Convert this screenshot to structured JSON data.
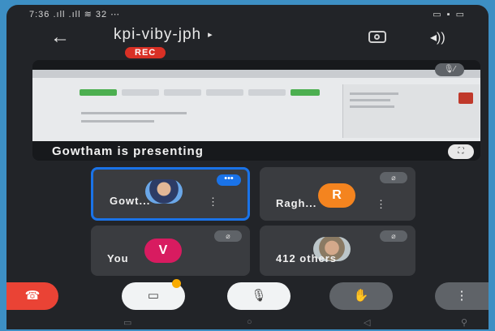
{
  "status_bar": {
    "left": "7:36 .ıll .ıll ≋ 32 ⋯",
    "right": "▭ ▪ ▭"
  },
  "header": {
    "meeting_name": "kpi-viby-jph",
    "caret": "▸",
    "rec_label": "REC",
    "back": "←",
    "speaker": "◂))"
  },
  "presentation": {
    "label": "Gowtham is presenting",
    "pin_icon": "🎙︎⁄",
    "fullscreen_icon": "⛶"
  },
  "tiles": [
    {
      "name": "Gowt...",
      "avatar": "",
      "more": "⋮",
      "badge": "•••",
      "active": true
    },
    {
      "name": "Ragh...",
      "avatar": "R",
      "more": "⋮",
      "avatar_color": "#f4841f"
    },
    {
      "name": "You",
      "avatar": "V",
      "avatar_color": "#d81b60"
    },
    {
      "name": "412 others",
      "avatar": ""
    }
  ],
  "controls": {
    "end": "☎",
    "cam": "▭",
    "mic": "🎙︎",
    "hand": "✋",
    "more": "⋮"
  },
  "navbar": {
    "left": "▭",
    "center": "○",
    "right": "◁",
    "extra": "⚲"
  }
}
